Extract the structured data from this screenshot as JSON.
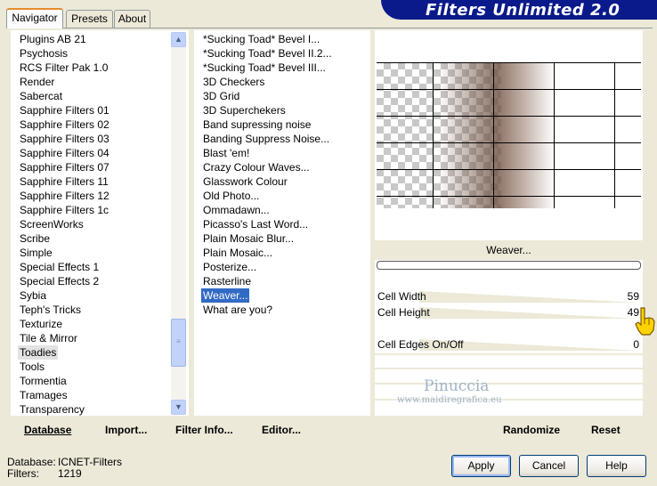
{
  "banner": {
    "title": "Filters Unlimited 2.0"
  },
  "tabs": [
    {
      "label": "Navigator",
      "active": true
    },
    {
      "label": "Presets",
      "active": false
    },
    {
      "label": "About",
      "active": false
    }
  ],
  "categories": {
    "items": [
      "Plugins AB 21",
      "Psychosis",
      "RCS Filter Pak 1.0",
      "Render",
      "Sabercat",
      "Sapphire Filters 01",
      "Sapphire Filters 02",
      "Sapphire Filters 03",
      "Sapphire Filters 04",
      "Sapphire Filters 07",
      "Sapphire Filters 11",
      "Sapphire Filters 12",
      "Sapphire Filters 1c",
      "ScreenWorks",
      "Scribe",
      "Simple",
      "Special Effects 1",
      "Special Effects 2",
      "Sybia",
      "Teph's Tricks",
      "Texturize",
      "Tile & Mirror",
      "Toadies",
      "Tools",
      "Tormentia",
      "Tramages",
      "Transparency"
    ],
    "selected": "Toadies"
  },
  "filters": {
    "items": [
      "*Sucking Toad*  Bevel I...",
      "*Sucking Toad*  Bevel II.2...",
      "*Sucking Toad*  Bevel III...",
      "3D Checkers",
      "3D Grid",
      "3D Superchekers",
      "Band supressing noise",
      "Banding Suppress Noise...",
      "Blast 'em!",
      "Crazy Colour Waves...",
      "Glasswork Colour",
      "Old Photo...",
      "Ommadawn...",
      "Picasso's Last Word...",
      "Plain Mosaic Blur...",
      "Plain Mosaic...",
      "Posterize...",
      "Rasterline",
      "Weaver...",
      "What are you?"
    ],
    "selected": "Weaver..."
  },
  "filter_name": "Weaver...",
  "params": [
    {
      "name": "Cell Width",
      "value": "59"
    },
    {
      "name": "Cell Height",
      "value": "49"
    },
    {
      "name": "Cell Edges On/Off",
      "value": "0"
    }
  ],
  "watermark": {
    "line1": "Pinuccia",
    "line2": "www.maidiregrafica.eu"
  },
  "toolbar": {
    "database": "Database",
    "import": "Import...",
    "filter_info": "Filter Info...",
    "editor": "Editor...",
    "randomize": "Randomize",
    "reset": "Reset"
  },
  "info": {
    "database_label": "Database:",
    "database_value": "ICNET-Filters",
    "filters_label": "Filters:",
    "filters_value": "1219"
  },
  "buttons": {
    "apply": "Apply",
    "cancel": "Cancel",
    "help": "Help"
  },
  "colors": {
    "banner": "#0a1a8a",
    "selection": "#316ac5",
    "tab_accent": "#e68b2c"
  }
}
